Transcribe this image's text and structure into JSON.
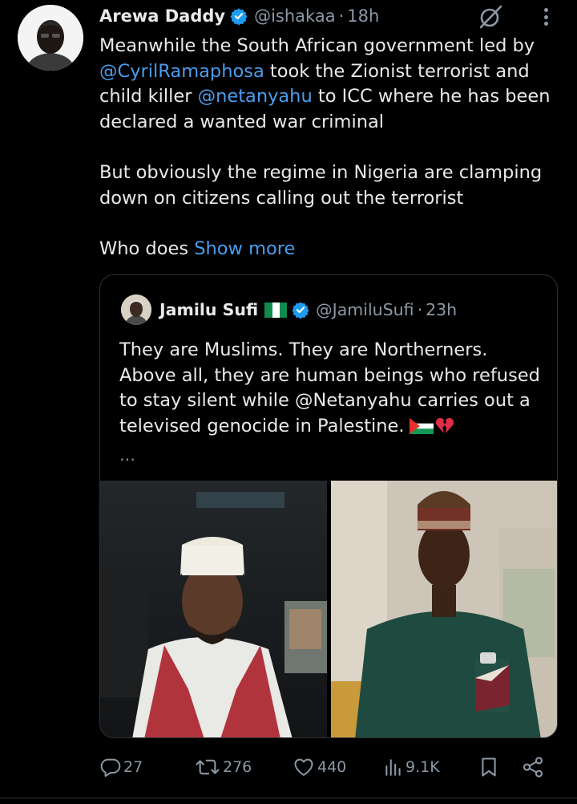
{
  "tweet": {
    "author_name": "Arewa Daddy",
    "handle": "@ishakaa",
    "time": "18h",
    "verified": true,
    "avatar_icon": "user-avatar",
    "body": {
      "p1_a": "Meanwhile the South African government led by ",
      "mention1": "@CyrilRamaphosa",
      "p1_b": " took the Zionist terrorist and child killer ",
      "mention2": "@netanyahu",
      "p1_c": " to ICC where he has been declared a wanted war criminal",
      "p2": "But obviously the regime in Nigeria are clamping down on citizens calling out the terrorist",
      "p3": "Who does ",
      "show_more": "Show more"
    }
  },
  "quote": {
    "author_name": "Jamilu Sufi",
    "handle": "@JamiluSufi",
    "time": "23h",
    "verified": true,
    "flag_icon": "nigeria-flag-emoji",
    "text": "They are Muslims. They are Northerners. Above all, they are human beings who refused to stay silent while @Netanyahu carries out a televised genocide in Palestine.",
    "emojis": [
      "palestine-flag-emoji",
      "broken-heart-emoji"
    ],
    "ellipsis": "…",
    "photos": [
      "man-in-white-cap-selfie-in-car",
      "man-in-embroidered-cap-green-kaftan"
    ]
  },
  "actions": {
    "reply": {
      "icon": "reply-icon",
      "count": "27"
    },
    "repost": {
      "icon": "repost-icon",
      "count": "276"
    },
    "like": {
      "icon": "heart-icon",
      "count": "440"
    },
    "views": {
      "icon": "views-icon",
      "count": "9.1K"
    },
    "bookmark": {
      "icon": "bookmark-icon"
    },
    "share": {
      "icon": "share-icon"
    }
  },
  "colors": {
    "background": "#000000",
    "text": "#e7e9ea",
    "secondary": "#8b98a5",
    "link": "#4a9ded",
    "verified": "#1d9bf0",
    "border": "#2f3336"
  }
}
